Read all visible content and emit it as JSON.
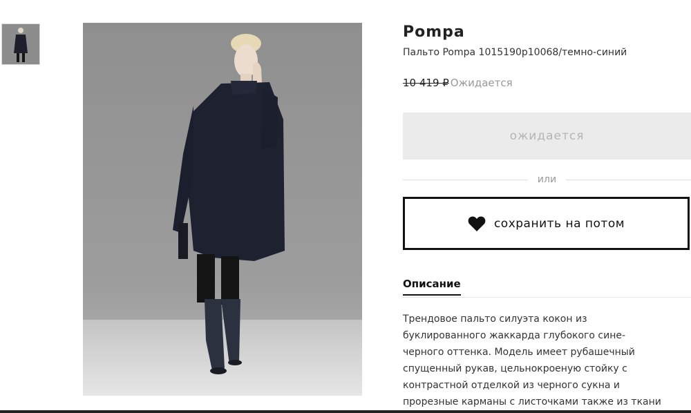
{
  "gallery": {
    "thumbnail_alt": "Pompa coat thumbnail",
    "main_alt": "Pompa coat main photo"
  },
  "product": {
    "brand": "Pompa",
    "subtitle": "Пальто Pompa 1015190р10068/темно-синий",
    "price_old": "10 419 ₽",
    "price_status": "Ожидается"
  },
  "actions": {
    "await_label": "ожидается",
    "or_label": "или",
    "save_label": "сохранить на потом",
    "save_icon": "heart-icon"
  },
  "tabs": {
    "description_label": "Описание"
  },
  "description": {
    "lines": [
      "Трендовое пальто силуэта кокон из",
      "буклированного жаккарда глубокого сине-",
      "черного оттенка. Модель имеет рубашечный",
      "спущенный рукав, цельнокроеную стойку с",
      "контрастной отделкой из черного сукна и",
      "прорезные карманы с листочками также из ткани"
    ]
  },
  "colors": {
    "accent": "#111111",
    "disabled_bg": "#ebebeb",
    "muted_text": "#999999"
  }
}
